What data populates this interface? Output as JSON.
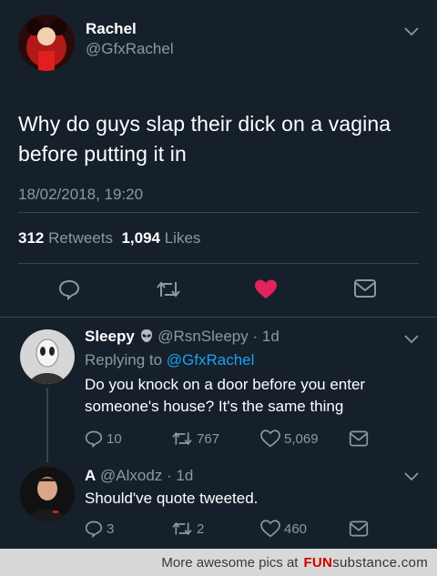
{
  "main_tweet": {
    "display_name": "Rachel",
    "handle": "@GfxRachel",
    "text": "Why do guys slap their dick on a vagina before putting it in",
    "timestamp": "18/02/2018, 19:20",
    "retweets_count": "312",
    "retweets_label": "Retweets",
    "likes_count": "1,094",
    "likes_label": "Likes",
    "liked_color": "#e0245e"
  },
  "replies": [
    {
      "display_name": "Sleepy",
      "handle": "@RsnSleepy",
      "age": "· 1d",
      "replying_prefix": "Replying to",
      "replying_handle": "@GfxRachel",
      "text": "Do you knock on a door before you enter someone's house? It's the same thing",
      "reply_count": "10",
      "retweet_count": "767",
      "like_count": "5,069"
    },
    {
      "display_name": "A",
      "handle": "@Alxodz",
      "age": "· 1d",
      "text": "Should've quote tweeted.",
      "reply_count": "3",
      "retweet_count": "2",
      "like_count": "460"
    }
  ],
  "watermark": {
    "prefix": "More awesome pics at",
    "brand_fun": "FUN",
    "brand_rest": "substance",
    "brand_tld": ".com"
  }
}
